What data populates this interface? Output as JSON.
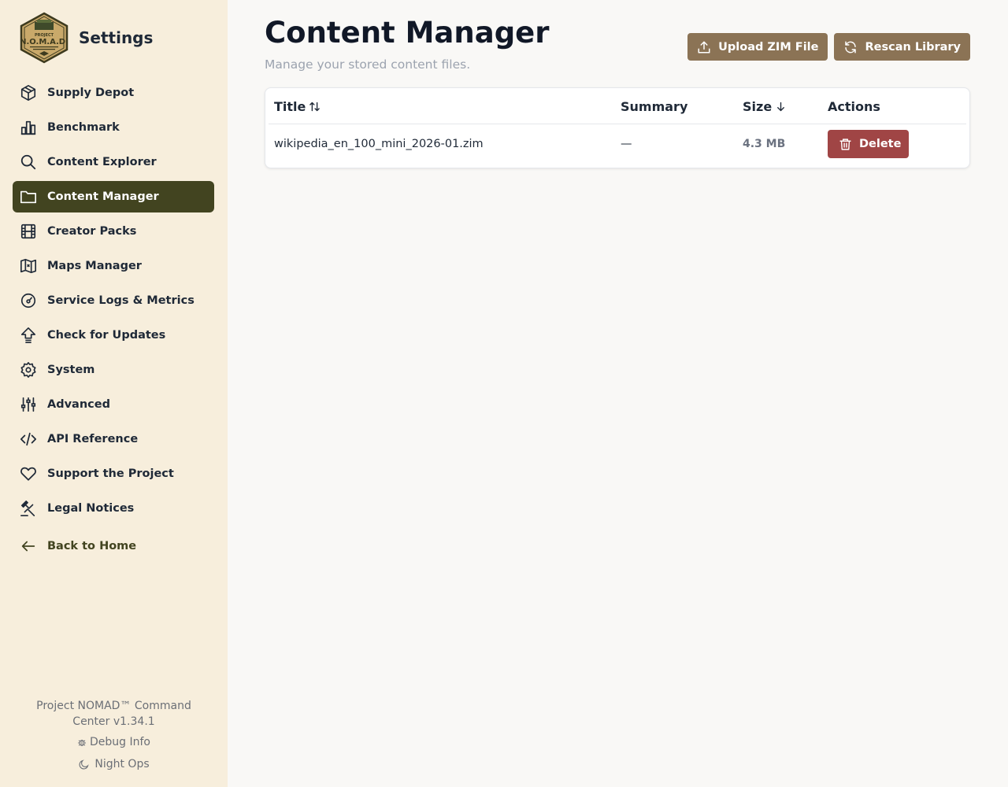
{
  "sidebar": {
    "title": "Settings",
    "items": [
      {
        "label": "Supply Depot",
        "icon": "box-icon"
      },
      {
        "label": "Benchmark",
        "icon": "bar-chart-icon"
      },
      {
        "label": "Content Explorer",
        "icon": "search-icon"
      },
      {
        "label": "Content Manager",
        "icon": "folder-icon",
        "active": true
      },
      {
        "label": "Creator Packs",
        "icon": "film-icon"
      },
      {
        "label": "Maps Manager",
        "icon": "map-icon"
      },
      {
        "label": "Service Logs & Metrics",
        "icon": "gauge-icon"
      },
      {
        "label": "Check for Updates",
        "icon": "upload-arrow-icon"
      },
      {
        "label": "System",
        "icon": "gear-icon"
      },
      {
        "label": "Advanced",
        "icon": "sliders-icon"
      },
      {
        "label": "API Reference",
        "icon": "code-icon"
      },
      {
        "label": "Support the Project",
        "icon": "heart-icon"
      },
      {
        "label": "Legal Notices",
        "icon": "gavel-icon"
      }
    ],
    "back_label": "Back to Home",
    "footer": {
      "version": "Project NOMAD™ Command Center v1.34.1",
      "debug_label": "Debug Info",
      "night_label": "Night Ops"
    }
  },
  "main": {
    "title": "Content Manager",
    "subtitle": "Manage your stored content files.",
    "upload_label": "Upload ZIM File",
    "rescan_label": "Rescan Library",
    "table": {
      "columns": [
        "Title",
        "Summary",
        "Size",
        "Actions"
      ],
      "rows": [
        {
          "title": "wikipedia_en_100_mini_2026-01.zim",
          "summary": "—",
          "size": "4.3 MB",
          "action": "Delete"
        }
      ]
    }
  },
  "colors": {
    "sidebar_bg": "#f7eedc",
    "active_nav": "#424420",
    "button": "#8b7355",
    "delete": "#a04545"
  }
}
